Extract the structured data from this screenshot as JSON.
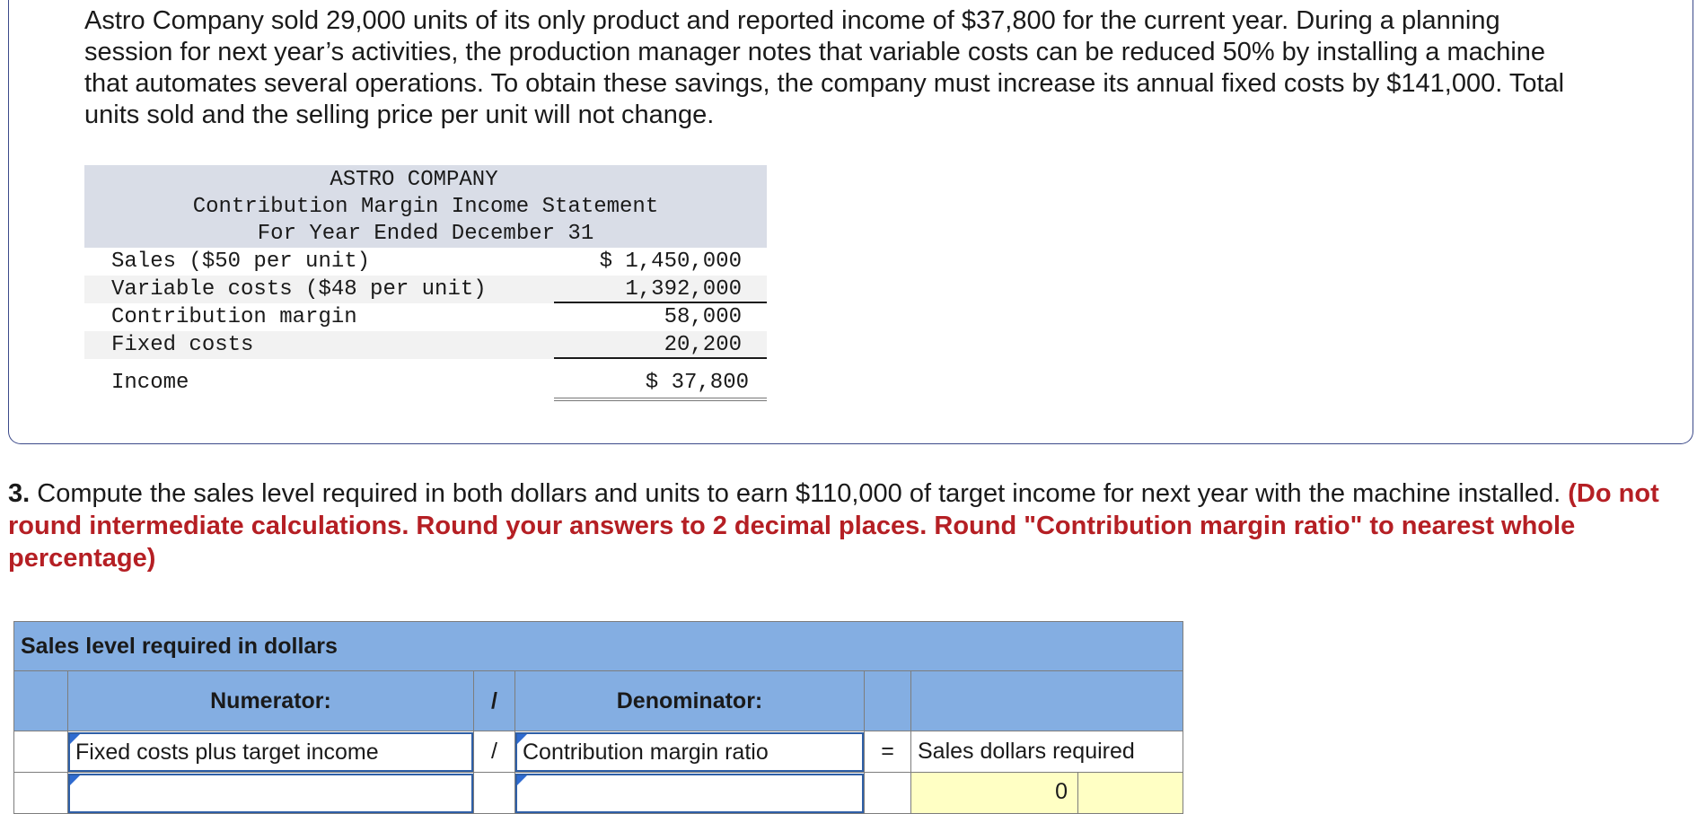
{
  "problem": {
    "intro": "Astro Company sold 29,000 units of its only product and reported income of $37,800 for the current year. During a planning session for next year’s activities, the production manager notes that variable costs can be reduced 50% by installing a machine that automates several operations. To obtain these savings, the company must increase its annual fixed costs by $141,000. Total units sold and the selling price per unit will not change."
  },
  "statement": {
    "company": "ASTRO COMPANY",
    "title": "Contribution Margin Income Statement",
    "period": "For Year Ended December 31",
    "rows": [
      {
        "label": "Sales ($50 per unit)",
        "amount": "$ 1,450,000"
      },
      {
        "label": "Variable costs ($48 per unit)",
        "amount": "1,392,000"
      },
      {
        "label": "Contribution margin",
        "amount": "58,000"
      },
      {
        "label": "Fixed costs",
        "amount": "20,200"
      },
      {
        "label": "Income",
        "amount": "$ 37,800"
      }
    ]
  },
  "question": {
    "number": "3.",
    "text": "Compute the sales level required in both dollars and units to earn $110,000 of target income for next year with the machine installed.",
    "note": "(Do not round intermediate calculations. Round your answers to 2 decimal places. Round \"Contribution margin ratio\" to nearest whole percentage)"
  },
  "answer_table": {
    "title": "Sales level required in dollars",
    "numerator_header": "Numerator:",
    "slash": "/",
    "denominator_header": "Denominator:",
    "equals": "=",
    "numerator_label": "Fixed costs plus target income",
    "denominator_label": "Contribution margin ratio",
    "result_label": "Sales dollars required",
    "numerator_value": "",
    "denominator_value": "",
    "result_value": "0"
  }
}
